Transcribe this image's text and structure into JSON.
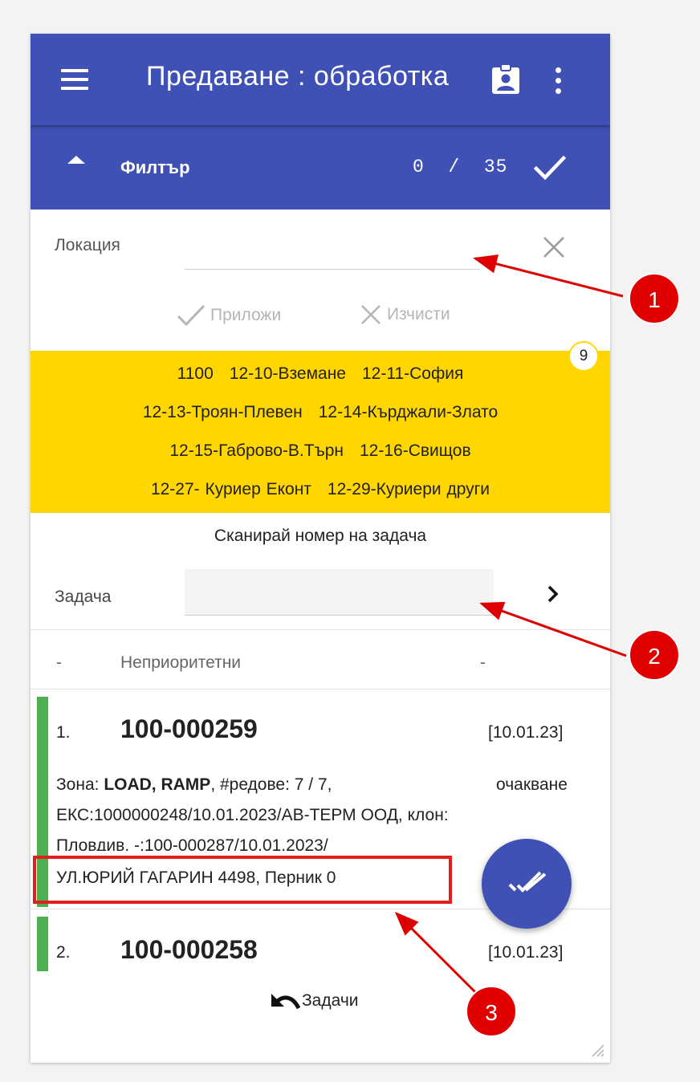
{
  "appbar": {
    "title": "Предаване : обработка",
    "menu_icon": "menu-icon",
    "badge_icon": "contact-badge-icon",
    "more_icon": "more-vert-icon"
  },
  "filterbar": {
    "label": "Филтър",
    "count": "0  /  35",
    "collapse_icon": "triangle-up-icon",
    "confirm_icon": "check-icon"
  },
  "location": {
    "label": "Локация",
    "value": "",
    "placeholder": "",
    "clear_icon": "close-icon"
  },
  "actions": {
    "apply": "Приложи",
    "reset": "Изчисти"
  },
  "locations_panel": {
    "count": "9",
    "rows": [
      [
        "1100",
        "12-10-Вземане",
        "12-11-София"
      ],
      [
        "12-13-Троян-Плевен",
        "12-14-Кърджали-Злато"
      ],
      [
        "12-15-Габрово-В.Търн",
        "12-16-Свищов"
      ],
      [
        "12-27- Куриер Еконт",
        "12-29-Куриери други"
      ]
    ]
  },
  "scan": {
    "label": "Сканирай номер на задача",
    "task_label": "Задача",
    "task_value": "",
    "go_icon": "chevron-right-icon"
  },
  "priority": {
    "left": "-",
    "label": "Неприоритетни",
    "right": "-"
  },
  "cards": [
    {
      "num": "1.",
      "code": "100-000259",
      "date": "[10.01.23]",
      "zone_prefix": "Зона: ",
      "zone": "LOAD, RAMP",
      "rows_text": ", #редове: 7 / 7,",
      "status": "очакване",
      "line2": "ЕКС:1000000248/10.01.2023/АВ-ТЕРМ ООД, клон:",
      "line3": "Пловдив, -:100-000287/10.01.2023/",
      "line4": "УЛ.ЮРИЙ ГАГАРИН 4498, Перник 0"
    },
    {
      "num": "2.",
      "code": "100-000258",
      "date": "[10.01.23]"
    }
  ],
  "fab": {
    "icon": "done-all-icon"
  },
  "bottom": {
    "tasks": "Задачи",
    "undo_icon": "undo-icon"
  },
  "annotations": {
    "markers": [
      "1",
      "2",
      "3"
    ],
    "marker_color": "#e00000"
  },
  "colors": {
    "primary": "#3f51b5",
    "highlight": "#ffd600",
    "status_bar": "#4caf50"
  }
}
